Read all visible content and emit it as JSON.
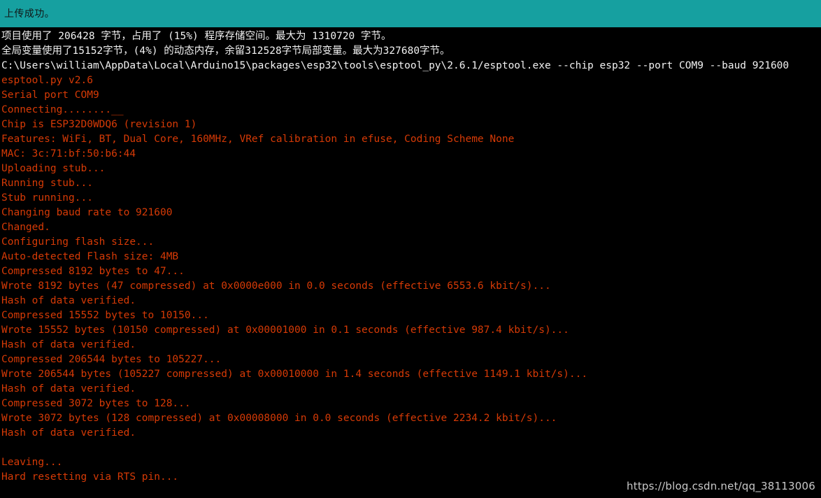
{
  "colors": {
    "status_bar_bg": "#16a0a0",
    "status_bar_text": "#101818",
    "console_bg": "#000000",
    "console_info_text": "#f2f2f2",
    "console_error_text": "#d63a06",
    "watermark_text": "#c9c9c9"
  },
  "status_bar": {
    "message": "上传成功。"
  },
  "console": {
    "lines": [
      {
        "text": "项目使用了 206428 字节，占用了 (15%) 程序存储空间。最大为 1310720 字节。",
        "style": "info"
      },
      {
        "text": "全局变量使用了15152字节，(4%) 的动态内存，余留312528字节局部变量。最大为327680字节。",
        "style": "info"
      },
      {
        "text": "C:\\Users\\william\\AppData\\Local\\Arduino15\\packages\\esp32\\tools\\esptool_py\\2.6.1/esptool.exe --chip esp32 --port COM9 --baud 921600",
        "style": "info"
      },
      {
        "text": "esptool.py v2.6",
        "style": "err"
      },
      {
        "text": "Serial port COM9",
        "style": "err"
      },
      {
        "text": "Connecting........__",
        "style": "err"
      },
      {
        "text": "Chip is ESP32D0WDQ6 (revision 1)",
        "style": "err"
      },
      {
        "text": "Features: WiFi, BT, Dual Core, 160MHz, VRef calibration in efuse, Coding Scheme None",
        "style": "err"
      },
      {
        "text": "MAC: 3c:71:bf:50:b6:44",
        "style": "err"
      },
      {
        "text": "Uploading stub...",
        "style": "err"
      },
      {
        "text": "Running stub...",
        "style": "err"
      },
      {
        "text": "Stub running...",
        "style": "err"
      },
      {
        "text": "Changing baud rate to 921600",
        "style": "err"
      },
      {
        "text": "Changed.",
        "style": "err"
      },
      {
        "text": "Configuring flash size...",
        "style": "err"
      },
      {
        "text": "Auto-detected Flash size: 4MB",
        "style": "err"
      },
      {
        "text": "Compressed 8192 bytes to 47...",
        "style": "err"
      },
      {
        "text": "Wrote 8192 bytes (47 compressed) at 0x0000e000 in 0.0 seconds (effective 6553.6 kbit/s)...",
        "style": "err"
      },
      {
        "text": "Hash of data verified.",
        "style": "err"
      },
      {
        "text": "Compressed 15552 bytes to 10150...",
        "style": "err"
      },
      {
        "text": "Wrote 15552 bytes (10150 compressed) at 0x00001000 in 0.1 seconds (effective 987.4 kbit/s)...",
        "style": "err"
      },
      {
        "text": "Hash of data verified.",
        "style": "err"
      },
      {
        "text": "Compressed 206544 bytes to 105227...",
        "style": "err"
      },
      {
        "text": "Wrote 206544 bytes (105227 compressed) at 0x00010000 in 1.4 seconds (effective 1149.1 kbit/s)...",
        "style": "err"
      },
      {
        "text": "Hash of data verified.",
        "style": "err"
      },
      {
        "text": "Compressed 3072 bytes to 128...",
        "style": "err"
      },
      {
        "text": "Wrote 3072 bytes (128 compressed) at 0x00008000 in 0.0 seconds (effective 2234.2 kbit/s)...",
        "style": "err"
      },
      {
        "text": "Hash of data verified.",
        "style": "err"
      },
      {
        "text": " ",
        "style": "blank"
      },
      {
        "text": "Leaving...",
        "style": "err"
      },
      {
        "text": "Hard resetting via RTS pin...",
        "style": "err"
      }
    ]
  },
  "watermark": {
    "text": "https://blog.csdn.net/qq_38113006"
  }
}
